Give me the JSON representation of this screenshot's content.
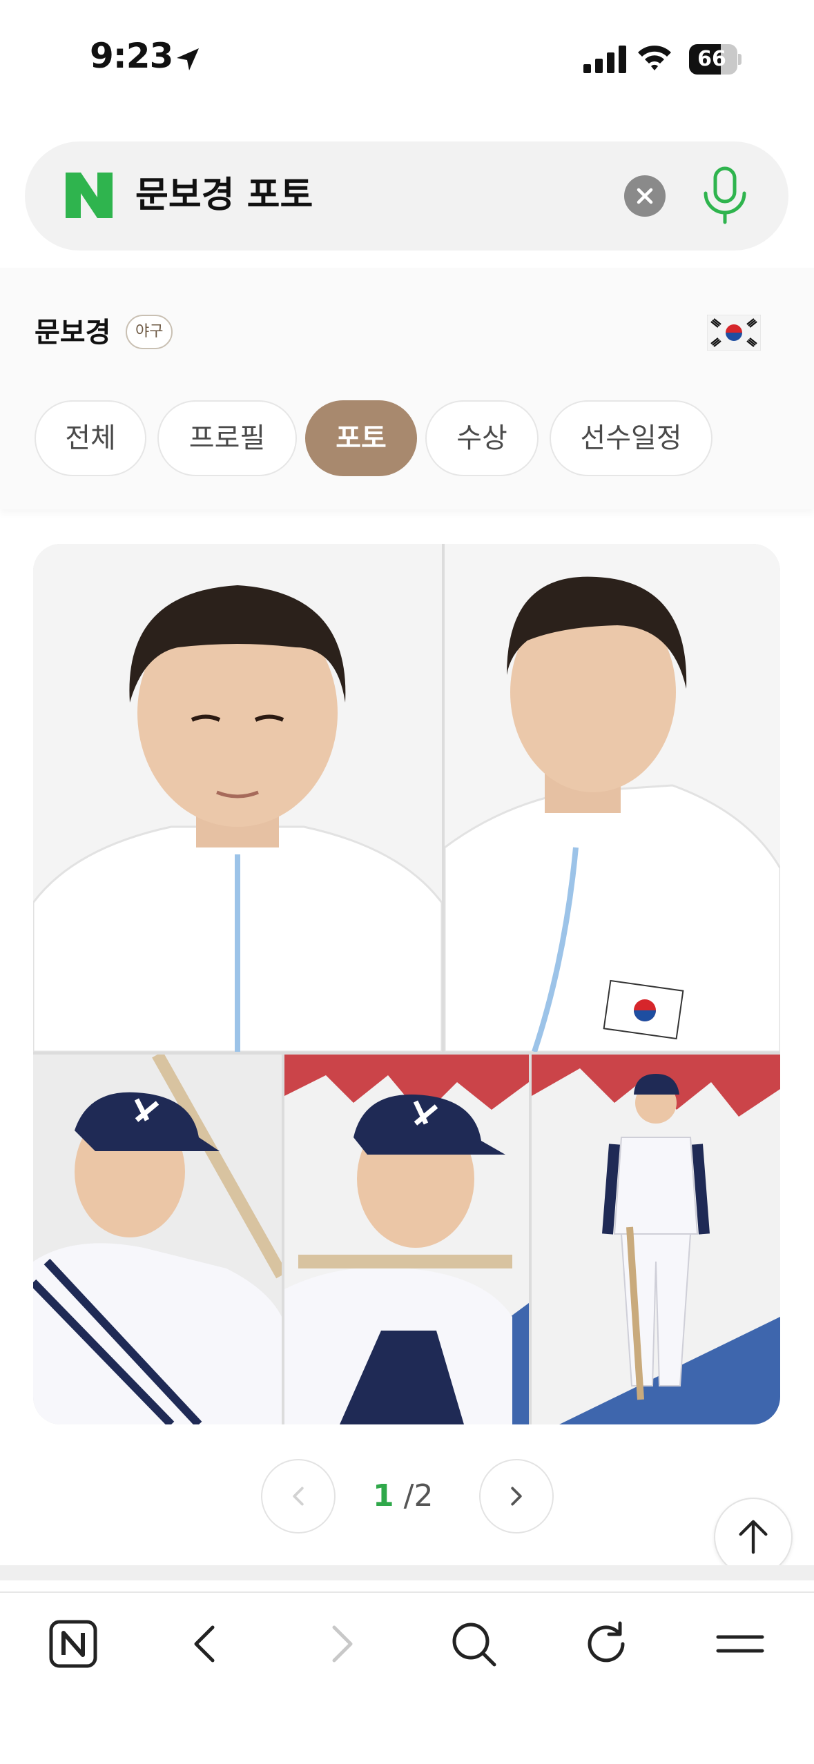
{
  "status_bar": {
    "time": "9:23",
    "battery": "66",
    "battery_level": 0.66
  },
  "search": {
    "query": "문보경 포토"
  },
  "entity": {
    "name": "문보경",
    "tag": "야구"
  },
  "tabs": [
    {
      "label": "전체",
      "active": false
    },
    {
      "label": "프로필",
      "active": false
    },
    {
      "label": "포토",
      "active": true
    },
    {
      "label": "수상",
      "active": false
    },
    {
      "label": "선수일정",
      "active": false
    }
  ],
  "pagination": {
    "current": "1",
    "total": "/2"
  },
  "colors": {
    "naver_green": "#2fb44e",
    "tab_active": "#a8896e",
    "page_current": "#2fa84a"
  },
  "icons": [
    "location-arrow-icon",
    "signal-icon",
    "wifi-icon",
    "naver-logo-icon",
    "clear-icon",
    "mic-icon",
    "korea-flag-icon",
    "chevron-left-icon",
    "chevron-right-icon",
    "arrow-up-icon",
    "naver-home-icon",
    "back-icon",
    "forward-icon",
    "search-icon",
    "reload-icon",
    "menu-icon"
  ]
}
